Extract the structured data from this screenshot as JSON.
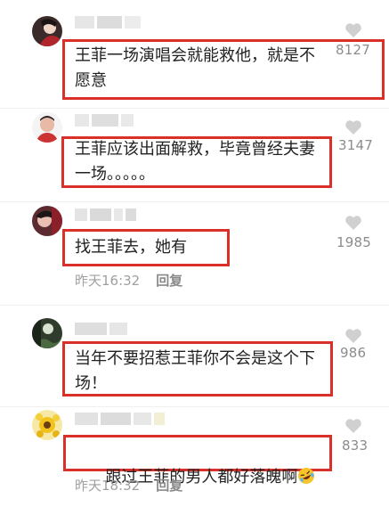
{
  "comments": [
    {
      "text": "王菲一场演唱会就能救他，就是不愿意",
      "like_count": "8127",
      "time": "",
      "reply_label": ""
    },
    {
      "text": "王菲应该出面解救，毕竟曾经夫妻一场。。。。。",
      "like_count": "3147",
      "time": "",
      "reply_label": ""
    },
    {
      "text": "找王菲去，她有",
      "like_count": "1985",
      "time": "昨天16:32",
      "reply_label": "回复"
    },
    {
      "text": "当年不要招惹王菲你不会是这个下场！",
      "like_count": "986",
      "time": "",
      "reply_label": ""
    },
    {
      "text": "跟过王菲的男人都好落魄啊",
      "emoji": "rofl-emoji",
      "like_count": "833",
      "time": "昨天18:32",
      "reply_label": "回复"
    }
  ],
  "icons": {
    "like": "heart-icon"
  },
  "colors": {
    "highlight": "#d9302a",
    "like_icon": "#d0d0d0",
    "meta_text": "#a0a0a0"
  }
}
